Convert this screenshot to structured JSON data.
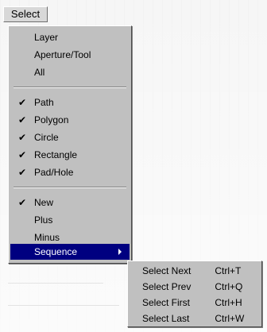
{
  "menubar": {
    "select_label": "Select"
  },
  "menu": {
    "items": [
      {
        "label": "Layer",
        "checked": false
      },
      {
        "label": "Aperture/Tool",
        "checked": false
      },
      {
        "label": "All",
        "checked": false
      },
      {
        "label": "Path",
        "checked": true
      },
      {
        "label": "Polygon",
        "checked": true
      },
      {
        "label": "Circle",
        "checked": true
      },
      {
        "label": "Rectangle",
        "checked": true
      },
      {
        "label": "Pad/Hole",
        "checked": true
      },
      {
        "label": "New",
        "checked": true
      },
      {
        "label": "Plus",
        "checked": false
      },
      {
        "label": "Minus",
        "checked": false
      },
      {
        "label": "Sequence",
        "checked": false,
        "has_submenu": true,
        "selected": true
      }
    ],
    "check_glyph": "✔"
  },
  "submenu": {
    "items": [
      {
        "label": "Select Next",
        "shortcut": "Ctrl+T"
      },
      {
        "label": "Select Prev",
        "shortcut": "Ctrl+Q"
      },
      {
        "label": "Select First",
        "shortcut": "Ctrl+H"
      },
      {
        "label": "Select Last",
        "shortcut": "Ctrl+W"
      }
    ]
  },
  "colors": {
    "menu_bg": "#c0c0c0",
    "highlight_bg": "#000080",
    "highlight_text": "#ffffff"
  }
}
